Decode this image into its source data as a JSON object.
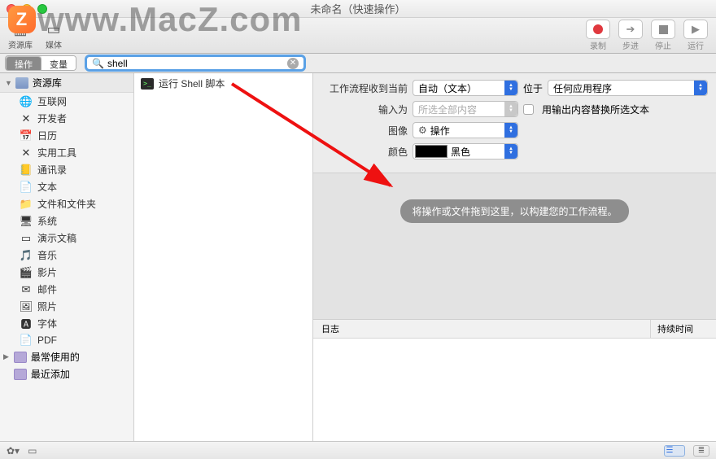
{
  "window": {
    "title": "未命名（快速操作）"
  },
  "watermark": {
    "text": "www.MacZ.com",
    "logo": "Z"
  },
  "toolbar": {
    "library": "资源库",
    "media": "媒体",
    "record": "录制",
    "step": "步进",
    "stop": "停止",
    "run": "运行"
  },
  "tabs": {
    "actions": "操作",
    "variables": "变量"
  },
  "search": {
    "value": "shell",
    "placeholder": ""
  },
  "sidebar": {
    "library_label": "资源库",
    "items": [
      {
        "label": "互联网",
        "icon": "🌐"
      },
      {
        "label": "开发者",
        "icon": "✕"
      },
      {
        "label": "日历",
        "icon": "📅"
      },
      {
        "label": "实用工具",
        "icon": "✕"
      },
      {
        "label": "通讯录",
        "icon": "📒"
      },
      {
        "label": "文本",
        "icon": "📄"
      },
      {
        "label": "文件和文件夹",
        "icon": "📁"
      },
      {
        "label": "系统",
        "icon": "🖥"
      },
      {
        "label": "演示文稿",
        "icon": "▭"
      },
      {
        "label": "音乐",
        "icon": "🎵"
      },
      {
        "label": "影片",
        "icon": "🎬"
      },
      {
        "label": "邮件",
        "icon": "✉"
      },
      {
        "label": "照片",
        "icon": "🖼"
      },
      {
        "label": "字体",
        "icon": "🅰"
      },
      {
        "label": "PDF",
        "icon": "📄"
      }
    ],
    "most_used": "最常使用的",
    "recent": "最近添加"
  },
  "results": {
    "run_shell": "运行 Shell 脚本"
  },
  "form": {
    "receives_label": "工作流程收到当前",
    "receives_value": "自动（文本）",
    "in_label": "位于",
    "in_value": "任何应用程序",
    "input_as_label": "输入为",
    "input_as_placeholder": "所选全部内容",
    "replace_label": "用输出内容替换所选文本",
    "image_label": "图像",
    "image_value": "操作",
    "color_label": "颜色",
    "color_value": "黑色"
  },
  "canvas": {
    "hint": "将操作或文件拖到这里，以构建您的工作流程。"
  },
  "log": {
    "col1": "日志",
    "col2": "持续时间"
  }
}
